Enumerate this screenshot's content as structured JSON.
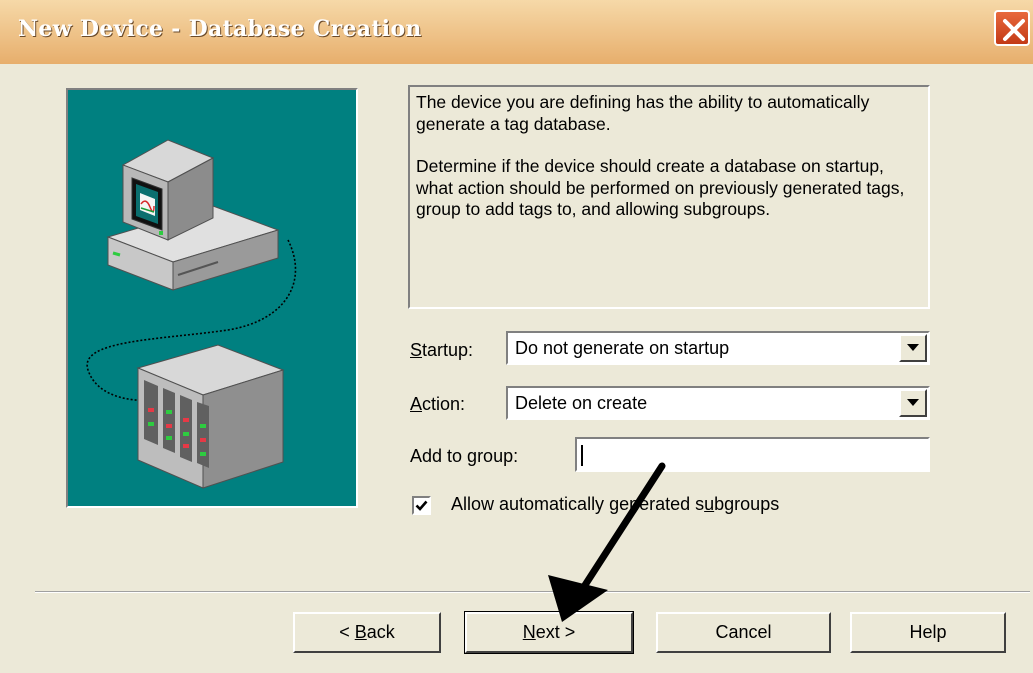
{
  "window": {
    "title": "New Device - Database Creation",
    "close_icon": "close-icon"
  },
  "description": {
    "paragraph1": "The device you are defining has the ability to automatically generate a tag database.",
    "paragraph2": "Determine if the device should create a database on startup, what action should be performed on previously generated tags, group to add tags to, and allowing subgroups."
  },
  "form": {
    "startup": {
      "label_accel": "S",
      "label_rest": "tartup:",
      "value": "Do not generate on startup"
    },
    "action": {
      "label_accel": "A",
      "label_rest": "ction:",
      "value": "Delete on create"
    },
    "add_to_group": {
      "label_pre": "Add to ",
      "label_accel": "g",
      "label_post": "roup:",
      "value": ""
    },
    "allow_subgroups": {
      "checked": true,
      "label_pre": "Allow automatically generated s",
      "label_accel": "u",
      "label_post": "bgroups"
    }
  },
  "buttons": {
    "back": {
      "pre": "< ",
      "accel": "B",
      "post": "ack"
    },
    "next": {
      "pre": "",
      "accel": "N",
      "post": "ext >"
    },
    "cancel": "Cancel",
    "help": "Help"
  },
  "colors": {
    "title_gradient_top": "#f6d9a8",
    "title_gradient_bottom": "#e7ae6c",
    "dialog_bg": "#ece9d8",
    "wizard_panel": "#008080",
    "close_button": "#d4512a",
    "arrow": "#000000"
  },
  "icons": [
    "close-icon",
    "computer-monitor-icon",
    "plc-device-icon",
    "dropdown-arrow-icon",
    "checkmark-icon",
    "pointer-arrow-annotation"
  ]
}
